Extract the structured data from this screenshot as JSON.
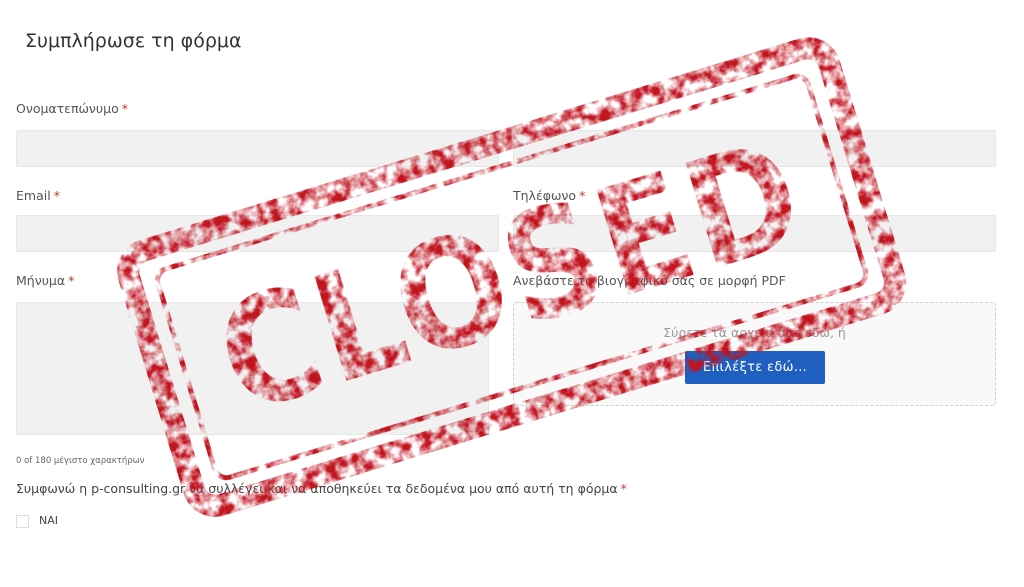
{
  "form": {
    "title": "Συμπλήρωσε τη φόρμα",
    "required_mark": "*",
    "fullname": {
      "label": "Ονοματεπώνυμο",
      "value": ""
    },
    "phone": {
      "label": "Τηλέφωνο",
      "value": ""
    },
    "email": {
      "label": "Email",
      "value": ""
    },
    "message": {
      "label": "Μήνυμα",
      "value": "",
      "char_count": "0 of 180 μέγιστο χαρακτήρων"
    },
    "upload": {
      "label": "Ανεβάστε το βιογραφικό σας σε μορφή PDF",
      "drop_text": "Σύρετε τα αρχεία σας εδώ, ή",
      "button_label": "Επιλέξτε εδώ..."
    },
    "consent": {
      "label": "Συμφωνώ η p-consulting.gr να συλλέγει και να αποθηκεύει τα δεδομένα μου από αυτή τη φόρμα",
      "option_label": "ΝΑΙ",
      "checked": false
    }
  },
  "stamp": {
    "text": "CLOSED",
    "color": "#c1121f"
  }
}
